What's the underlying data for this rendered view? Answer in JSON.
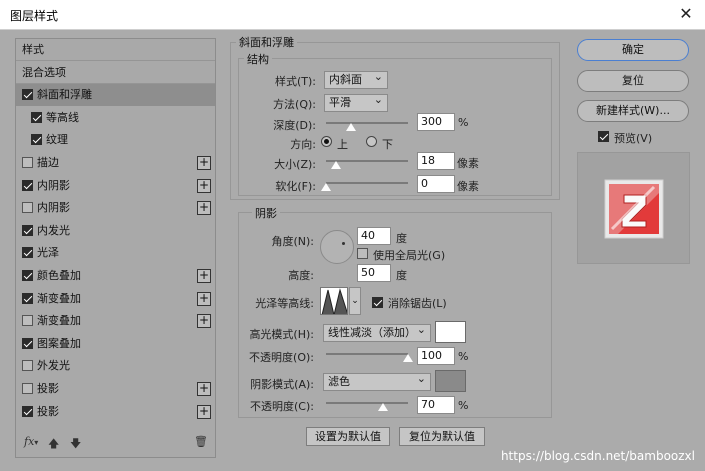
{
  "window": {
    "title": "图层样式",
    "close_icon": "close-icon"
  },
  "left_panel": {
    "items": [
      {
        "label": "样式",
        "checkbox": null,
        "plus": false,
        "indent": false,
        "selected": false
      },
      {
        "label": "混合选项",
        "checkbox": null,
        "plus": false,
        "indent": false,
        "selected": false
      },
      {
        "label": "斜面和浮雕",
        "checkbox": true,
        "plus": false,
        "indent": false,
        "selected": true
      },
      {
        "label": "等高线",
        "checkbox": true,
        "plus": false,
        "indent": true,
        "selected": false
      },
      {
        "label": "纹理",
        "checkbox": true,
        "plus": false,
        "indent": true,
        "selected": false
      },
      {
        "label": "描边",
        "checkbox": false,
        "plus": true,
        "indent": false,
        "selected": false
      },
      {
        "label": "内阴影",
        "checkbox": true,
        "plus": true,
        "indent": false,
        "selected": false
      },
      {
        "label": "内阴影",
        "checkbox": false,
        "plus": true,
        "indent": false,
        "selected": false
      },
      {
        "label": "内发光",
        "checkbox": true,
        "plus": false,
        "indent": false,
        "selected": false
      },
      {
        "label": "光泽",
        "checkbox": true,
        "plus": false,
        "indent": false,
        "selected": false
      },
      {
        "label": "颜色叠加",
        "checkbox": true,
        "plus": true,
        "indent": false,
        "selected": false
      },
      {
        "label": "渐变叠加",
        "checkbox": true,
        "plus": true,
        "indent": false,
        "selected": false
      },
      {
        "label": "渐变叠加",
        "checkbox": false,
        "plus": true,
        "indent": false,
        "selected": false
      },
      {
        "label": "图案叠加",
        "checkbox": true,
        "plus": false,
        "indent": false,
        "selected": false
      },
      {
        "label": "外发光",
        "checkbox": false,
        "plus": false,
        "indent": false,
        "selected": false
      },
      {
        "label": "投影",
        "checkbox": false,
        "plus": true,
        "indent": false,
        "selected": false
      },
      {
        "label": "投影",
        "checkbox": true,
        "plus": true,
        "indent": false,
        "selected": false
      }
    ],
    "footer": {
      "fx_label": "fx",
      "up_icon": "arrow-up-icon",
      "down_icon": "arrow-down-icon",
      "trash_icon": "trash-icon"
    }
  },
  "bevel": {
    "section_title": "斜面和浮雕",
    "structure_title": "结构",
    "style_label": "样式(T):",
    "style_value": "内斜面",
    "method_label": "方法(Q):",
    "method_value": "平滑",
    "depth_label": "深度(D):",
    "depth_value": "300",
    "depth_unit": "%",
    "depth_level": 0.3,
    "direction_label": "方向:",
    "direction_up": "上",
    "direction_down": "下",
    "size_label": "大小(Z):",
    "size_value": "18",
    "size_unit": "像素",
    "size_level": 0.12,
    "soften_label": "软化(F):",
    "soften_value": "0",
    "soften_unit": "像素",
    "soften_level": 0.0
  },
  "shading": {
    "title": "阴影",
    "angle_label": "角度(N):",
    "angle_value": "40",
    "angle_unit": "度",
    "global_light_label": "使用全局光(G)",
    "global_light": false,
    "altitude_label": "高度:",
    "altitude_value": "50",
    "altitude_unit": "度",
    "gloss_label": "光泽等高线:",
    "antialias_label": "消除锯齿(L)",
    "antialias": true,
    "highlight_mode_label": "高光模式(H):",
    "highlight_mode_value": "线性减淡（添加）",
    "highlight_color": "#ffffff",
    "highlight_opacity_label": "不透明度(O):",
    "highlight_opacity_value": "100",
    "highlight_opacity_level": 1.0,
    "shadow_mode_label": "阴影模式(A):",
    "shadow_mode_value": "滤色",
    "shadow_color": "#8a8a8a",
    "shadow_opacity_label": "不透明度(C):",
    "shadow_opacity_value": "70",
    "shadow_opacity_level": 0.7,
    "percent": "%"
  },
  "bottom_buttons": {
    "make_default": "设置为默认值",
    "reset_default": "复位为默认值"
  },
  "right_buttons": {
    "ok": "确定",
    "reset": "复位",
    "new_style": "新建样式(W)...",
    "preview_label": "预览(V)",
    "preview": true
  },
  "watermark": "https://blog.csdn.net/bamboozxl"
}
